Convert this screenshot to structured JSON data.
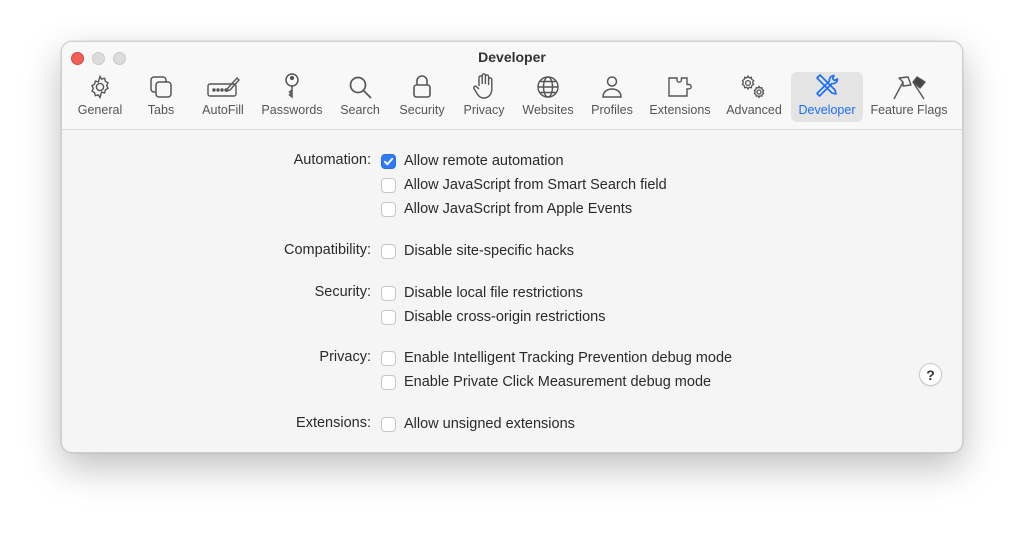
{
  "window": {
    "title": "Developer"
  },
  "tabs": [
    {
      "label": "General",
      "icon": "gear-icon"
    },
    {
      "label": "Tabs",
      "icon": "tabs-icon"
    },
    {
      "label": "AutoFill",
      "icon": "autofill-icon"
    },
    {
      "label": "Passwords",
      "icon": "key-icon"
    },
    {
      "label": "Search",
      "icon": "magnifier-icon"
    },
    {
      "label": "Security",
      "icon": "lock-icon"
    },
    {
      "label": "Privacy",
      "icon": "hand-icon"
    },
    {
      "label": "Websites",
      "icon": "globe-icon"
    },
    {
      "label": "Profiles",
      "icon": "person-icon"
    },
    {
      "label": "Extensions",
      "icon": "puzzle-icon"
    },
    {
      "label": "Advanced",
      "icon": "gears-icon"
    },
    {
      "label": "Developer",
      "icon": "tools-icon",
      "selected": true
    },
    {
      "label": "Feature Flags",
      "icon": "flags-icon"
    }
  ],
  "sections": [
    {
      "label": "Automation:",
      "options": [
        {
          "text": "Allow remote automation",
          "checked": true
        },
        {
          "text": "Allow JavaScript from Smart Search field",
          "checked": false
        },
        {
          "text": "Allow JavaScript from Apple Events",
          "checked": false
        }
      ]
    },
    {
      "label": "Compatibility:",
      "options": [
        {
          "text": "Disable site-specific hacks",
          "checked": false
        }
      ]
    },
    {
      "label": "Security:",
      "options": [
        {
          "text": "Disable local file restrictions",
          "checked": false
        },
        {
          "text": "Disable cross-origin restrictions",
          "checked": false
        }
      ]
    },
    {
      "label": "Privacy:",
      "options": [
        {
          "text": "Enable Intelligent Tracking Prevention debug mode",
          "checked": false
        },
        {
          "text": "Enable Private Click Measurement debug mode",
          "checked": false
        }
      ]
    },
    {
      "label": "Extensions:",
      "options": [
        {
          "text": "Allow unsigned extensions",
          "checked": false
        }
      ]
    }
  ],
  "help_button": {
    "label": "?"
  },
  "colors": {
    "accent": "#1a6ef2",
    "checkbox_checked": "#2f7bf5",
    "close": "#ee5f57"
  }
}
